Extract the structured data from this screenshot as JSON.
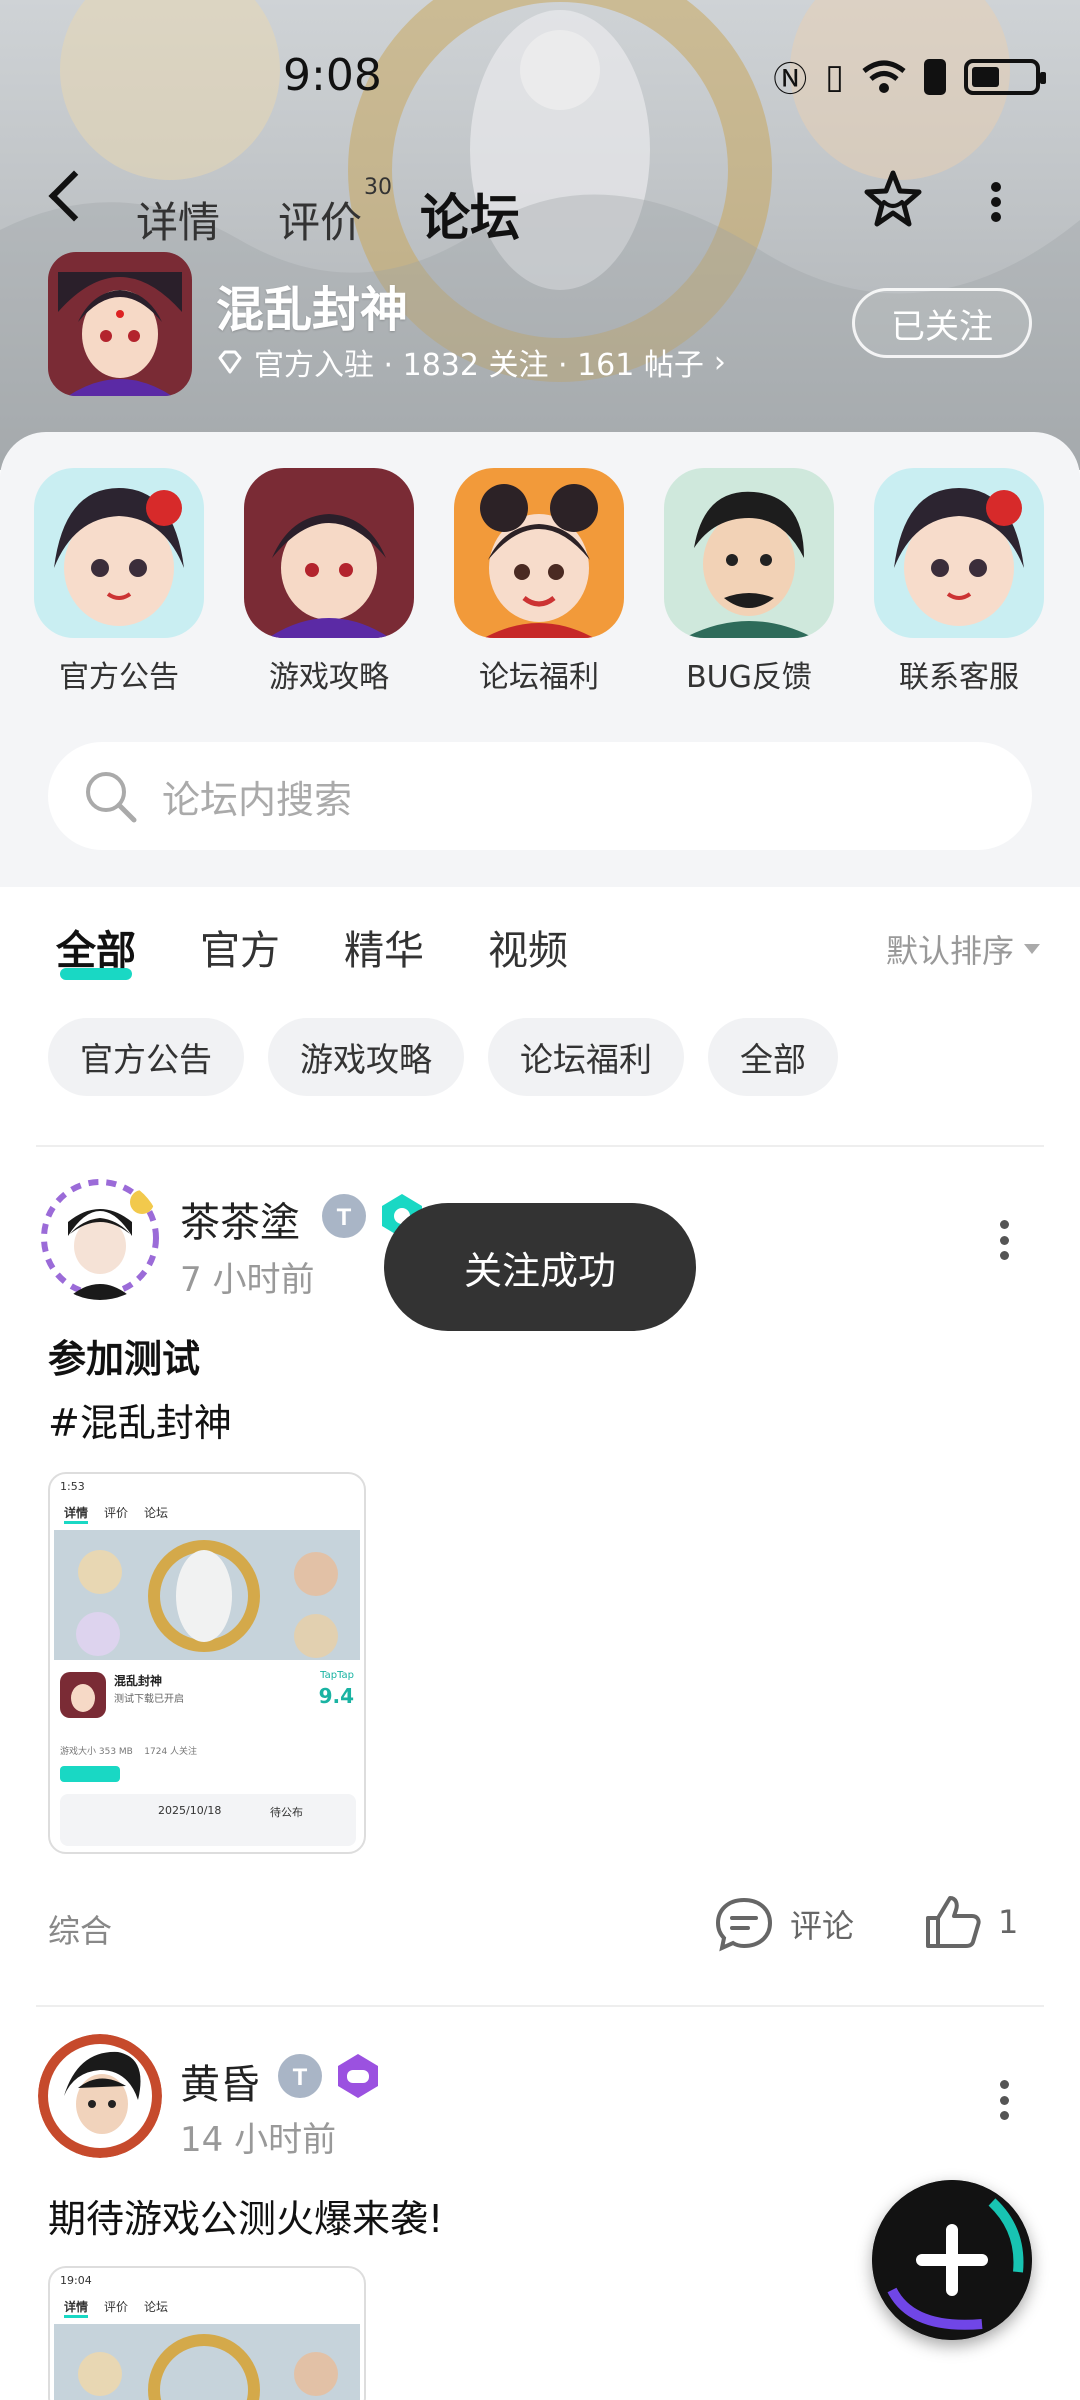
{
  "status_bar": {
    "time": "9:08"
  },
  "header": {
    "tabs": [
      {
        "label": "详情"
      },
      {
        "label": "评价",
        "count": "30"
      },
      {
        "label": "论坛"
      }
    ],
    "active_tab": "论坛",
    "game_name": "混乱封神",
    "meta": "官方入驻 · 1832 关注 · 161 帖子",
    "follow_button": "已关注"
  },
  "categories": [
    {
      "label": "官方公告"
    },
    {
      "label": "游戏攻略"
    },
    {
      "label": "论坛福利"
    },
    {
      "label": "BUG反馈"
    },
    {
      "label": "联系客服"
    }
  ],
  "search": {
    "placeholder": "论坛内搜索"
  },
  "tabs": [
    "全部",
    "官方",
    "精华",
    "视频"
  ],
  "sort": "默认排序",
  "chips": [
    "官方公告",
    "游戏攻略",
    "论坛福利",
    "全部"
  ],
  "posts": [
    {
      "author": "茶茶塗",
      "time": "7 小时前",
      "title": "参加测试",
      "body": "#混乱封神",
      "tag": "综合",
      "comment_label": "评论",
      "like_count": "1",
      "screenshot": {
        "time": "1:53",
        "tabs": [
          "详情",
          "评价",
          "论坛"
        ],
        "game_name": "混乱封神",
        "sub": "测试下载已开启",
        "score_label": "TapTap",
        "score": "9.4",
        "info": "游戏大小 353 MB    1724 人关注",
        "date": "2025/10/18",
        "status": "待公布"
      }
    },
    {
      "author": "黄昏",
      "time": "14 小时前",
      "body": "期待游戏公测火爆来袭!",
      "screenshot": {
        "time": "19:04",
        "tabs": [
          "详情",
          "评价",
          "论坛"
        ]
      }
    }
  ],
  "toast": "关注成功",
  "colors": {
    "accent": "#19d8c4",
    "toast_bg": "#333333"
  }
}
